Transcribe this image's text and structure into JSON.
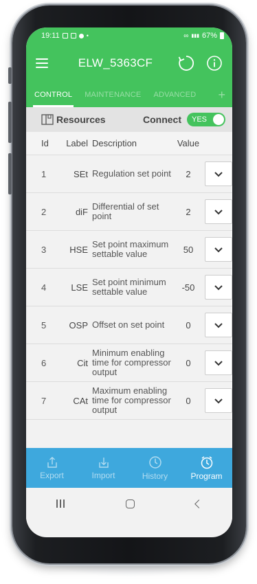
{
  "status_bar": {
    "time": "19:11",
    "right_text": "67%"
  },
  "app": {
    "title": "ELW_5363CF"
  },
  "tabs": [
    {
      "label": "CONTROL",
      "active": true
    },
    {
      "label": "MAINTENANCE",
      "active": false
    },
    {
      "label": "ADVANCED",
      "active": false
    }
  ],
  "resources_bar": {
    "resources_label": "Resources",
    "connect_label": "Connect",
    "toggle_text": "YES"
  },
  "table": {
    "headers": {
      "id": "Id",
      "label": "Label",
      "description": "Description",
      "value": "Value"
    },
    "rows": [
      {
        "id": "1",
        "label": "SEt",
        "description": "Regulation set point",
        "value": "2"
      },
      {
        "id": "2",
        "label": "diF",
        "description": "Differential of set point",
        "value": "2"
      },
      {
        "id": "3",
        "label": "HSE",
        "description": "Set point maximum settable value",
        "value": "50"
      },
      {
        "id": "4",
        "label": "LSE",
        "description": "Set point minimum settable value",
        "value": "-50"
      },
      {
        "id": "5",
        "label": "OSP",
        "description": "Offset on set point",
        "value": "0"
      },
      {
        "id": "6",
        "label": "Cit",
        "description": "Minimum enabling time for compressor output",
        "value": "0"
      },
      {
        "id": "7",
        "label": "CAt",
        "description": "Maximum enabling time for compressor output",
        "value": "0"
      }
    ]
  },
  "bottom_bar": {
    "items": [
      {
        "label": "Export",
        "icon": "export-icon"
      },
      {
        "label": "Import",
        "icon": "import-icon"
      },
      {
        "label": "History",
        "icon": "history-icon"
      },
      {
        "label": "Program",
        "icon": "program-icon"
      }
    ]
  },
  "colors": {
    "brand_green": "#44c35d",
    "bottom_blue": "#3ea8dd"
  }
}
